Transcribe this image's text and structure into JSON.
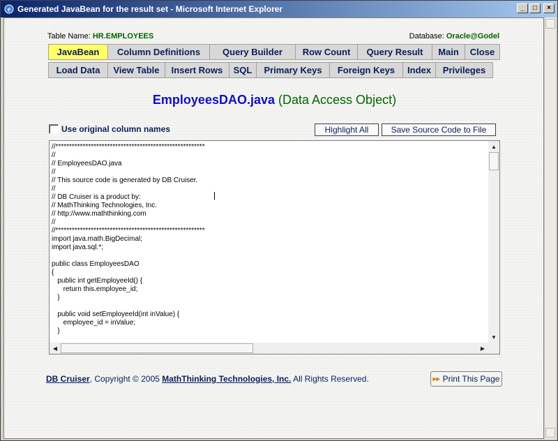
{
  "window": {
    "title": "Generated JavaBean for the result set - Microsoft Internet Explorer",
    "minimize": "_",
    "maximize": "□",
    "close": "×"
  },
  "info": {
    "table_label": "Table Name:",
    "table_value": "HR.EMPLOYEES",
    "db_label": "Database:",
    "db_value": "Oracle@Godel"
  },
  "nav": {
    "row1": [
      {
        "label": "JavaBean",
        "active": true
      },
      {
        "label": "Column Definitions"
      },
      {
        "label": "Query Builder"
      },
      {
        "label": "Row Count"
      },
      {
        "label": "Query Result"
      },
      {
        "label": "Main"
      },
      {
        "label": "Close"
      }
    ],
    "row2": [
      {
        "label": "Load Data"
      },
      {
        "label": "View Table"
      },
      {
        "label": "Insert Rows"
      },
      {
        "label": "SQL"
      },
      {
        "label": "Primary Keys"
      },
      {
        "label": "Foreign Keys"
      },
      {
        "label": "Index"
      },
      {
        "label": "Privileges"
      }
    ]
  },
  "heading": {
    "file": "EmployeesDAO.java",
    "desc": "(Data Access Object)"
  },
  "options": {
    "use_original_names": "Use original column names",
    "highlight_all": "Highlight All",
    "save_source": "Save Source Code to File"
  },
  "code": "//*******************************************************\n//\n// EmployeesDAO.java\n//\n// This source code is generated by DB Cruiser.\n//\n// DB Cruiser is a product by:\n// MathThinking Technologies, Inc.\n// http://www.maththinking.com\n//\n//*******************************************************\nimport java.math.BigDecimal;\nimport java.sql.*;\n\npublic class EmployeesDAO\n{\n   public int getEmployeeId() {\n      return this.employee_id;\n   }\n\n   public void setEmployeeId(int inValue) {\n      employee_id = inValue;\n   }",
  "footer": {
    "product_link": "DB Cruiser",
    "copyright": ",  Copyright © 2005 ",
    "company_link": "MathThinking Technologies, Inc.",
    "rights": "  All Rights Reserved.",
    "print_button": "Print This Page",
    "print_icon": "▸▸"
  }
}
